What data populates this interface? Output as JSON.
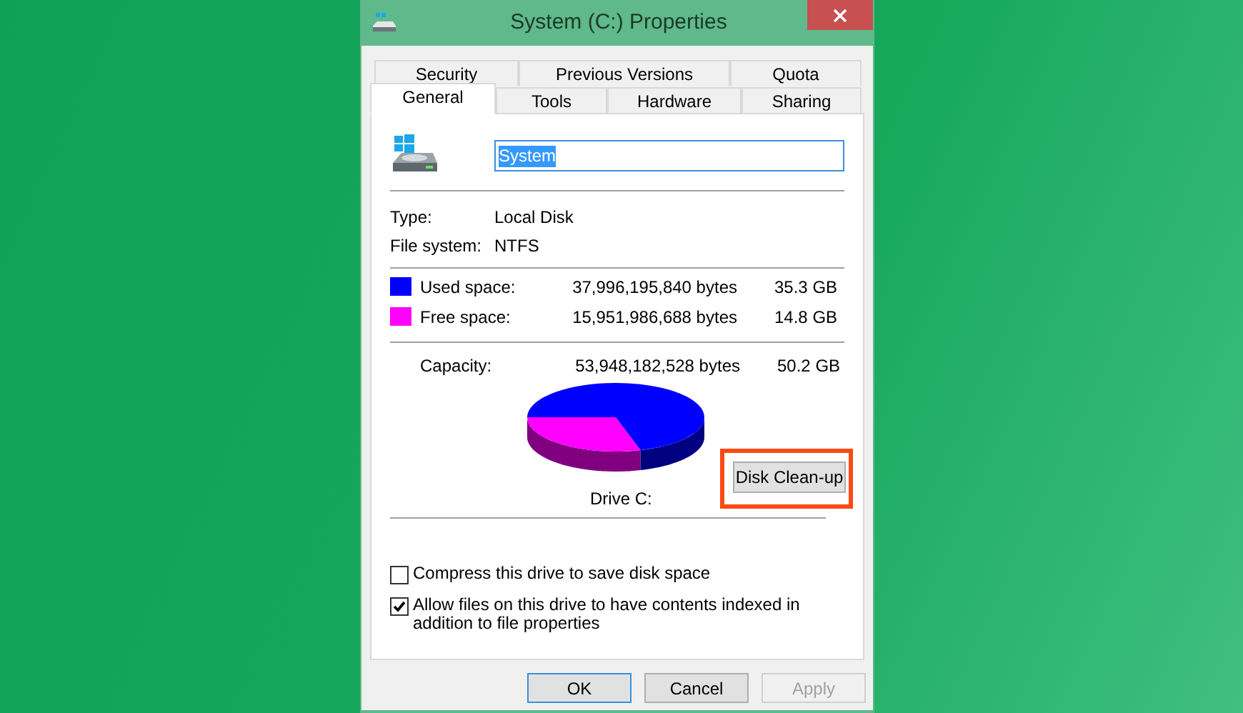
{
  "window": {
    "title": "System (C:) Properties"
  },
  "tab_rows": [
    [
      {
        "label": "Security",
        "selected": false
      },
      {
        "label": "Previous Versions",
        "selected": false
      },
      {
        "label": "Quota",
        "selected": false
      }
    ],
    [
      {
        "label": "General",
        "selected": true
      },
      {
        "label": "Tools",
        "selected": false
      },
      {
        "label": "Hardware",
        "selected": false
      },
      {
        "label": "Sharing",
        "selected": false
      }
    ]
  ],
  "name_field": {
    "value": "System"
  },
  "info": [
    {
      "label": "Type:",
      "value": "Local Disk"
    },
    {
      "label": "File system:",
      "value": "NTFS"
    }
  ],
  "space": [
    {
      "label": "Used space:",
      "bytes": "37,996,195,840 bytes",
      "size": "35.3 GB",
      "color": "#0000ff"
    },
    {
      "label": "Free space:",
      "bytes": "15,951,986,688 bytes",
      "size": "14.8 GB",
      "color": "#ff00ff"
    }
  ],
  "capacity": {
    "label": "Capacity:",
    "bytes": "53,948,182,528 bytes",
    "size": "50.2 GB"
  },
  "drive_label": "Drive C:",
  "cleanup_button": {
    "label": "Disk Clean-up",
    "highlighted": true
  },
  "options": [
    {
      "label": "Compress this drive to save disk space",
      "checked": false
    },
    {
      "label": "Allow files on this drive to have contents indexed in addition to file properties",
      "checked": true
    }
  ],
  "buttons": [
    {
      "label": "OK",
      "disabled": false,
      "default": true
    },
    {
      "label": "Cancel",
      "disabled": false,
      "default": false
    },
    {
      "label": "Apply",
      "disabled": true,
      "default": false
    }
  ]
}
